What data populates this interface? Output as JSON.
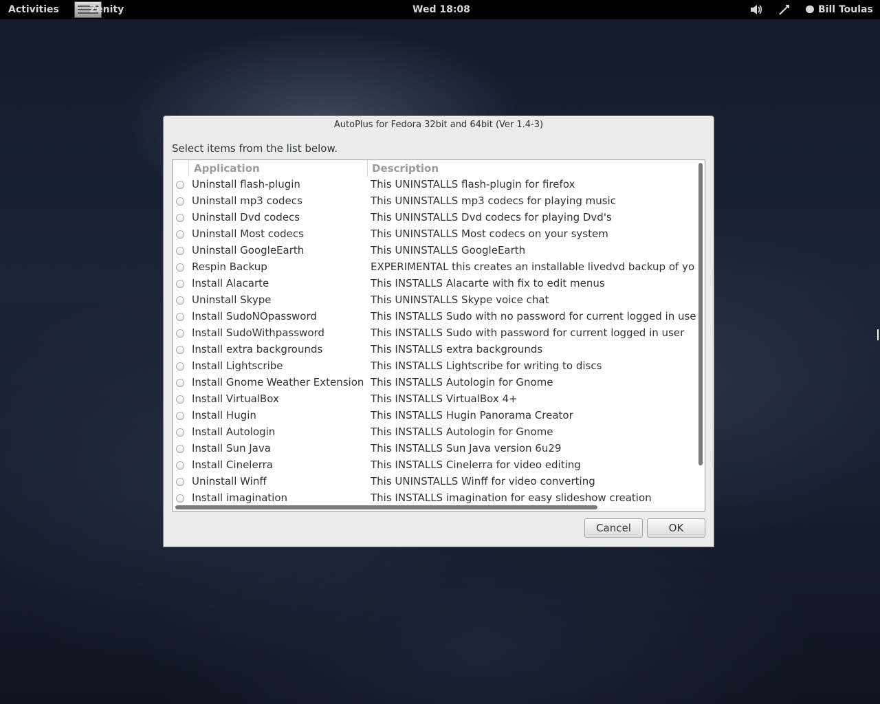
{
  "topbar": {
    "activities": "Activities",
    "app_name": "Zenity",
    "clock": "Wed 18:08",
    "user": "Bill Toulas"
  },
  "dialog": {
    "title": "AutoPlus for Fedora 32bit and 64bit (Ver 1.4-3)",
    "prompt": "Select items from the list below.",
    "columns": {
      "application": "Application",
      "description": "Description"
    },
    "rows": [
      {
        "app": "Uninstall flash-plugin",
        "desc": "This UNINSTALLS flash-plugin for firefox"
      },
      {
        "app": "Uninstall mp3 codecs",
        "desc": "This UNINSTALLS mp3 codecs for playing music"
      },
      {
        "app": "Uninstall Dvd codecs",
        "desc": "This UNINSTALLS Dvd codecs for playing Dvd's"
      },
      {
        "app": "Uninstall Most codecs",
        "desc": "This UNINSTALLS Most codecs on your system"
      },
      {
        "app": "Uninstall GoogleEarth",
        "desc": "This UNINSTALLS GoogleEarth"
      },
      {
        "app": "Respin Backup",
        "desc": "EXPERIMENTAL this creates an installable livedvd backup of yo"
      },
      {
        "app": "Install Alacarte",
        "desc": "This INSTALLS Alacarte with fix to edit menus"
      },
      {
        "app": "Uninstall Skype",
        "desc": "This UNINSTALLS Skype voice chat"
      },
      {
        "app": "Install SudoNOpassword",
        "desc": "This INSTALLS Sudo with no password for current logged in use"
      },
      {
        "app": "Install SudoWithpassword",
        "desc": "This INSTALLS Sudo with password for current logged in user"
      },
      {
        "app": "Install extra backgrounds",
        "desc": "This INSTALLS extra backgrounds"
      },
      {
        "app": "Install Lightscribe",
        "desc": "This INSTALLS Lightscribe for writing to discs"
      },
      {
        "app": "Install Gnome Weather Extension",
        "desc": "This INSTALLS Autologin for Gnome"
      },
      {
        "app": "Install VirtualBox",
        "desc": "This INSTALLS VirtualBox 4+"
      },
      {
        "app": "Install Hugin",
        "desc": "This INSTALLS Hugin Panorama Creator"
      },
      {
        "app": "Install Autologin",
        "desc": "This INSTALLS Autologin for Gnome"
      },
      {
        "app": "Install Sun Java",
        "desc": "This INSTALLS Sun Java version 6u29"
      },
      {
        "app": "Install Cinelerra",
        "desc": "This INSTALLS Cinelerra for video editing"
      },
      {
        "app": "Uninstall Winff",
        "desc": "This UNINSTALLS Winff for video converting"
      },
      {
        "app": "Install imagination",
        "desc": "This INSTALLS imagination for easy slideshow creation"
      }
    ],
    "buttons": {
      "cancel": "Cancel",
      "ok": "OK"
    }
  }
}
